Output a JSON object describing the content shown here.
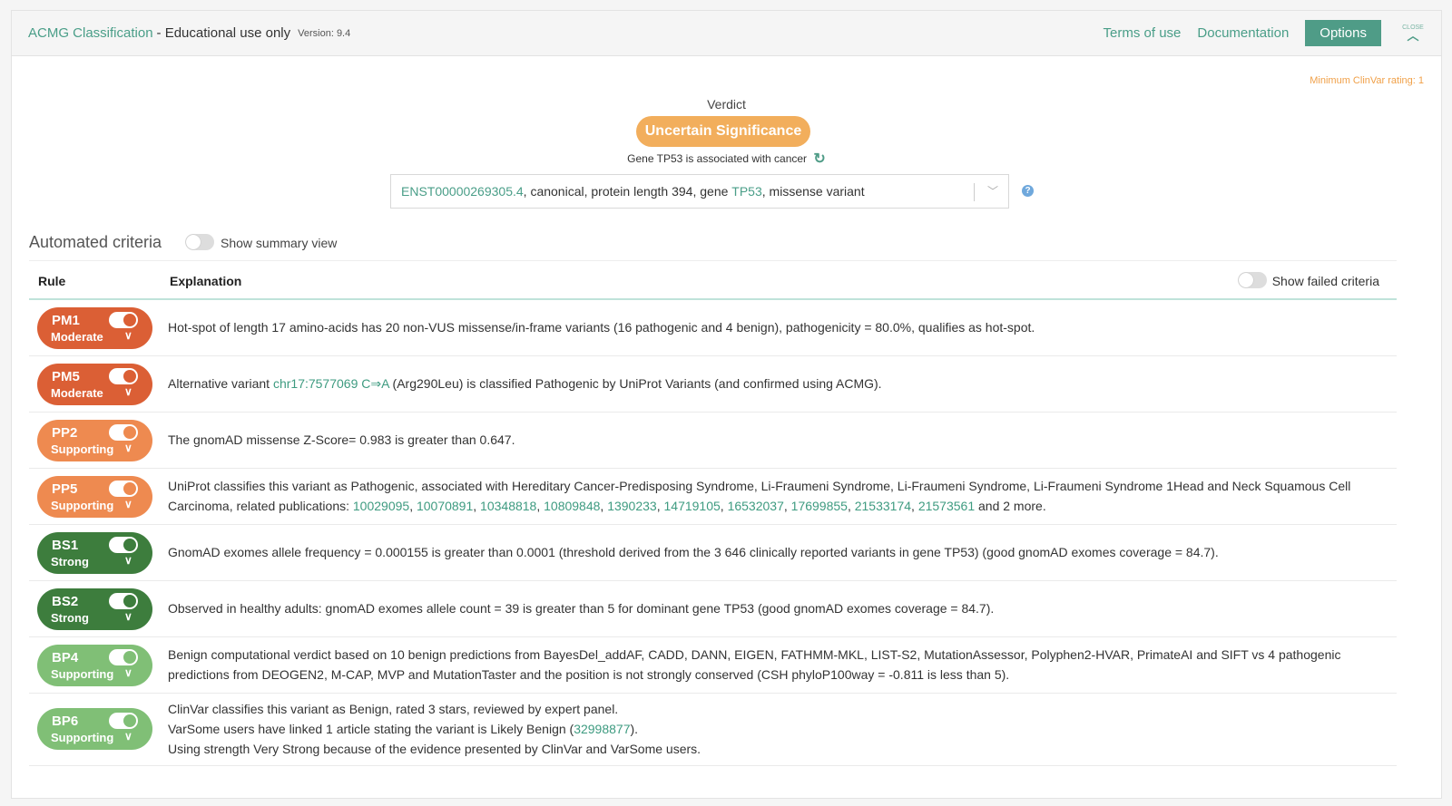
{
  "header": {
    "title": "ACMG Classification",
    "subtitle": "- Educational use only",
    "version": "Version: 9.4",
    "terms_label": "Terms of use",
    "docs_label": "Documentation",
    "options_label": "Options",
    "close_label": "CLOSE",
    "close_icon": "chevron-up-icon"
  },
  "min_clinvar": "Minimum ClinVar rating: 1",
  "verdict": {
    "label": "Verdict",
    "value": "Uncertain Significance",
    "color": "#f2ae5c",
    "gene_note": "Gene TP53 is associated with cancer",
    "refresh_icon": "refresh-icon"
  },
  "transcript": {
    "id": "ENST00000269305.4",
    "text1": ", canonical, protein length 394, gene ",
    "gene": "TP53",
    "text2": ", missense variant",
    "help_icon": "question-circle-icon"
  },
  "criteria": {
    "title": "Automated criteria",
    "summary_toggle_label": "Show summary view",
    "summary_toggle_on": false,
    "columns": [
      "Rule",
      "Explanation"
    ],
    "failed_toggle_label": "Show failed criteria",
    "failed_toggle_on": false,
    "rows": [
      {
        "code": "PM1",
        "strength": "Moderate",
        "enabled": true,
        "color": "#db5f35",
        "parts": [
          {
            "t": "Hot-spot of length 17 amino-acids has 20 non-VUS missense/in-frame variants (16 pathogenic and 4 benign), pathogenicity = 80.0%, qualifies as hot-spot."
          }
        ]
      },
      {
        "code": "PM5",
        "strength": "Moderate",
        "enabled": true,
        "color": "#db5f35",
        "parts": [
          {
            "t": "Alternative variant "
          },
          {
            "t": "chr17:7577069 C⇒A",
            "link": true
          },
          {
            "t": " (Arg290Leu) is classified Pathogenic by UniProt Variants (and confirmed using ACMG)."
          }
        ]
      },
      {
        "code": "PP2",
        "strength": "Supporting",
        "enabled": true,
        "color": "#ee8a50",
        "parts": [
          {
            "t": "The gnomAD missense Z-Score= 0.983 is greater than 0.647."
          }
        ]
      },
      {
        "code": "PP5",
        "strength": "Supporting",
        "enabled": true,
        "color": "#ee8a50",
        "parts": [
          {
            "t": "UniProt classifies this variant as Pathogenic, associated with Hereditary Cancer-Predisposing Syndrome, Li-Fraumeni Syndrome, Li-Fraumeni Syndrome, Li-Fraumeni Syndrome 1Head and Neck Squamous Cell Carcinoma, related publications: "
          },
          {
            "t": "10029095",
            "link": true
          },
          {
            "t": ", "
          },
          {
            "t": "10070891",
            "link": true
          },
          {
            "t": ", "
          },
          {
            "t": "10348818",
            "link": true
          },
          {
            "t": ", "
          },
          {
            "t": "10809848",
            "link": true
          },
          {
            "t": ", "
          },
          {
            "t": "1390233",
            "link": true
          },
          {
            "t": ", "
          },
          {
            "t": "14719105",
            "link": true
          },
          {
            "t": ", "
          },
          {
            "t": "16532037",
            "link": true
          },
          {
            "t": ", "
          },
          {
            "t": "17699855",
            "link": true
          },
          {
            "t": ", "
          },
          {
            "t": "21533174",
            "link": true
          },
          {
            "t": ", "
          },
          {
            "t": "21573561",
            "link": true
          },
          {
            "t": " and 2 more."
          }
        ]
      },
      {
        "code": "BS1",
        "strength": "Strong",
        "enabled": true,
        "color": "#3d7d3d",
        "parts": [
          {
            "t": "GnomAD exomes allele frequency = 0.000155 is greater than 0.0001 (threshold derived from the 3 646 clinically reported variants in gene TP53) (good gnomAD exomes coverage = 84.7)."
          }
        ]
      },
      {
        "code": "BS2",
        "strength": "Strong",
        "enabled": true,
        "color": "#3d7d3d",
        "parts": [
          {
            "t": "Observed in healthy adults: gnomAD exomes allele count = 39 is greater than 5 for dominant gene TP53 (good gnomAD exomes coverage = 84.7)."
          }
        ]
      },
      {
        "code": "BP4",
        "strength": "Supporting",
        "enabled": true,
        "color": "#80bf76",
        "parts": [
          {
            "t": "Benign computational verdict based on 10 benign predictions from BayesDel_addAF, CADD, DANN, EIGEN, FATHMM-MKL, LIST-S2, MutationAssessor, Polyphen2-HVAR, PrimateAI and SIFT vs 4 pathogenic predictions from DEOGEN2, M-CAP, MVP and MutationTaster and the position is not strongly conserved (CSH phyloP100way = -0.811 is less than 5)."
          }
        ]
      },
      {
        "code": "BP6",
        "strength": "Supporting",
        "enabled": true,
        "color": "#80bf76",
        "parts": [
          {
            "t": "ClinVar classifies this variant as Benign, rated 3 stars, reviewed by expert panel."
          },
          {
            "br": true
          },
          {
            "t": "VarSome users have linked 1 article stating the variant is Likely Benign ("
          },
          {
            "t": "32998877",
            "link": true
          },
          {
            "t": ")."
          },
          {
            "br": true
          },
          {
            "t": "Using strength Very Strong because of the evidence presented by ClinVar and VarSome users."
          }
        ]
      }
    ]
  }
}
